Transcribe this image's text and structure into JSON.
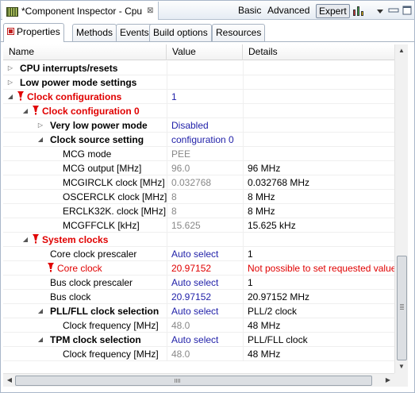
{
  "window": {
    "title": "*Component Inspector - Cpu",
    "title_icon": "component-inspector-icon",
    "close_glyph": "⊠",
    "modes": {
      "basic": "Basic",
      "advanced": "Advanced",
      "expert": "Expert"
    },
    "selected_mode": "Expert"
  },
  "tabs": [
    {
      "label": "Properties",
      "active": true
    },
    {
      "label": "Methods",
      "active": false
    },
    {
      "label": "Events",
      "active": false
    },
    {
      "label": "Build options",
      "active": false
    },
    {
      "label": "Resources",
      "active": false
    }
  ],
  "columns": {
    "name": "Name",
    "value": "Value",
    "details": "Details"
  },
  "rows": [
    {
      "name": "CPU interrupts/resets",
      "value": "",
      "details": "",
      "level": 0,
      "expander": "collapsed",
      "warn": false,
      "style": "bold"
    },
    {
      "name": "Low power mode settings",
      "value": "",
      "details": "",
      "level": 0,
      "expander": "collapsed",
      "warn": false,
      "style": "bold"
    },
    {
      "name": "Clock configurations",
      "value": "1",
      "details": "",
      "level": 0,
      "expander": "expanded",
      "warn": true,
      "style": "bold-red"
    },
    {
      "name": "Clock configuration 0",
      "value": "",
      "details": "",
      "level": 1,
      "expander": "expanded",
      "warn": true,
      "style": "bold-red"
    },
    {
      "name": "Very low power mode",
      "value": "Disabled",
      "details": "",
      "level": 2,
      "expander": "collapsed",
      "warn": false,
      "style": "bold"
    },
    {
      "name": "Clock source setting",
      "value": "configuration 0",
      "details": "",
      "level": 2,
      "expander": "expanded",
      "warn": false,
      "style": "bold"
    },
    {
      "name": "MCG mode",
      "value": "PEE",
      "details": "",
      "level": 3,
      "expander": "none",
      "warn": false,
      "style": "normal",
      "value_style": "gray"
    },
    {
      "name": "MCG output [MHz]",
      "value": "96.0",
      "details": "96 MHz",
      "level": 3,
      "expander": "none",
      "warn": false,
      "style": "normal",
      "value_style": "gray"
    },
    {
      "name": "MCGIRCLK clock [MHz]",
      "value": "0.032768",
      "details": "0.032768 MHz",
      "level": 3,
      "expander": "none",
      "warn": false,
      "style": "normal",
      "value_style": "gray"
    },
    {
      "name": "OSCERCLK clock [MHz]",
      "value": "8",
      "details": "8 MHz",
      "level": 3,
      "expander": "none",
      "warn": false,
      "style": "normal",
      "value_style": "gray"
    },
    {
      "name": "ERCLK32K. clock [MHz]",
      "value": "8",
      "details": "8 MHz",
      "level": 3,
      "expander": "none",
      "warn": false,
      "style": "normal",
      "value_style": "gray"
    },
    {
      "name": "MCGFFCLK [kHz]",
      "value": "15.625",
      "details": "15.625 kHz",
      "level": 3,
      "expander": "none",
      "warn": false,
      "style": "normal",
      "value_style": "gray"
    },
    {
      "name": "System clocks",
      "value": "",
      "details": "",
      "level": 1,
      "expander": "expanded",
      "warn": true,
      "style": "bold-red"
    },
    {
      "name": "Core clock prescaler",
      "value": "Auto select",
      "details": "1",
      "level": 2,
      "expander": "none",
      "warn": false,
      "style": "normal",
      "value_style": "blue"
    },
    {
      "name": "Core clock",
      "value": "20.97152",
      "details": "Not possible to set requested value",
      "level": 2,
      "expander": "none",
      "warn": true,
      "style": "red",
      "value_style": "red",
      "details_style": "red"
    },
    {
      "name": "Bus clock prescaler",
      "value": "Auto select",
      "details": "1",
      "level": 2,
      "expander": "none",
      "warn": false,
      "style": "normal",
      "value_style": "blue"
    },
    {
      "name": "Bus clock",
      "value": "20.97152",
      "details": "20.97152 MHz",
      "level": 2,
      "expander": "none",
      "warn": false,
      "style": "normal",
      "value_style": "blue"
    },
    {
      "name": "PLL/FLL clock selection",
      "value": "Auto select",
      "details": "PLL/2 clock",
      "level": 2,
      "expander": "expanded",
      "warn": false,
      "style": "bold",
      "value_style": "blue"
    },
    {
      "name": "Clock frequency [MHz]",
      "value": "48.0",
      "details": "48 MHz",
      "level": 3,
      "expander": "none",
      "warn": false,
      "style": "normal",
      "value_style": "gray"
    },
    {
      "name": "TPM clock selection",
      "value": "Auto select",
      "details": "PLL/FLL clock",
      "level": 2,
      "expander": "expanded",
      "warn": false,
      "style": "bold",
      "value_style": "blue"
    },
    {
      "name": "Clock frequency [MHz]",
      "value": "48.0",
      "details": "48 MHz",
      "level": 3,
      "expander": "none",
      "warn": false,
      "style": "normal",
      "value_style": "gray"
    }
  ],
  "colors": {
    "error": "#e00000",
    "link": "#1f1fa8",
    "readonly": "#888888"
  }
}
